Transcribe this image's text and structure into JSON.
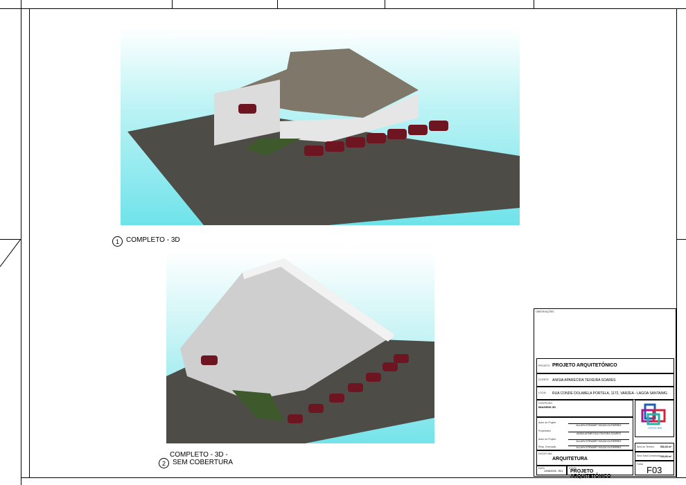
{
  "views": [
    {
      "number": "1",
      "caption": "COMPLETO - 3D"
    },
    {
      "number": "2",
      "caption": "COMPLETO - 3D - SEM COBERTURA"
    }
  ],
  "title_block": {
    "notes_label": "OBSERVAÇÕES",
    "project_label": "PROJETO",
    "project": "PROJETO ARQUITETÔNICO",
    "owner_label": "CLIENTE",
    "owner": "ANISIA APARECIDA TEIXEIRA SOARES",
    "address_label": "LOCAL",
    "address": "RUA CONDE DOLABELA PORTELA, 1172, VARZEA - LAGOA SANTA/MG",
    "content_label": "CONTEÚDO",
    "content": "IMAGENS 3D",
    "author_label": "Autor do Projeto",
    "author": "ALLAYN STEWART SOUZA GUTIERREZ",
    "owner2_label": "Proprietário",
    "owner2": "ANISIA APARECIDA TEIXEIRA SOARES",
    "resp_label": "Autor do Projeto",
    "resp": "ALLAYN STEWART SOUZA GUTIERREZ",
    "exec_label": "Resp. Execução",
    "exec": "ALLAYN STEWART SOUZA GUTIERREZ",
    "discipline_label": "DISCIPLINA",
    "discipline": "ARQUITETURA",
    "date_label": "DATA",
    "date": "19/08/2025 - R01",
    "stage_label": "ETAPA",
    "stage": "PROJETO ARQUITETÔNICO",
    "logo_text": "OFFICE BIM",
    "area_label1": "Área do Terreno",
    "area1": "532,33 m²",
    "area_label2": "Área Total Construída",
    "area2": "203,93 m²",
    "sheet_label": "Folha",
    "sheet": "F03"
  }
}
